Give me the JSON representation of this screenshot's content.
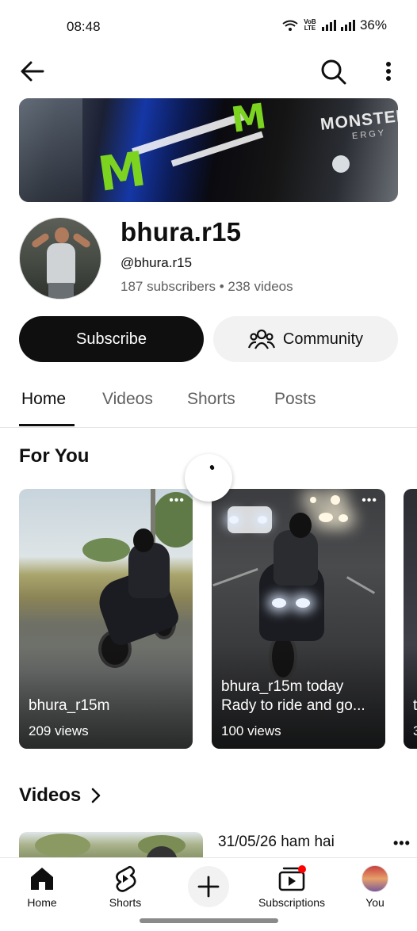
{
  "status_bar": {
    "time": "08:48",
    "volte": "VoB LTE",
    "battery": "36%"
  },
  "topbar": {
    "back_icon": "arrow-left-icon",
    "search_icon": "search-icon",
    "more_icon": "more-vertical-icon"
  },
  "banner": {
    "brand_text": "MONSTER",
    "brand_sub": "ERGY"
  },
  "channel": {
    "name": "bhura.r15",
    "handle": "@bhura.r15",
    "stats": "187 subscribers • 238 videos"
  },
  "actions": {
    "subscribe_label": "Subscribe",
    "community_label": "Community",
    "community_icon": "people-icon"
  },
  "tabs": [
    {
      "label": "Home",
      "active": true
    },
    {
      "label": "Videos",
      "active": false
    },
    {
      "label": "Shorts",
      "active": false
    },
    {
      "label": "Posts",
      "active": false
    }
  ],
  "for_you": {
    "title": "For You",
    "shorts": [
      {
        "title": "bhura_r15m",
        "views": "209 views"
      },
      {
        "title_line1": "bhura_r15m  today",
        "title_line2": "Rady to ride  and go...",
        "views": "100 views"
      },
      {
        "title": "t",
        "views": "3"
      }
    ]
  },
  "videos_section": {
    "title": "Videos",
    "first_video_title": "31/05/26   ham hai",
    "chevron_icon": "chevron-right-icon"
  },
  "bottom_nav": {
    "items": [
      {
        "label": "Home",
        "icon": "home-icon"
      },
      {
        "label": "Shorts",
        "icon": "shorts-icon"
      },
      {
        "label": "",
        "icon": "plus-icon"
      },
      {
        "label": "Subscriptions",
        "icon": "subscriptions-icon"
      },
      {
        "label": "You",
        "icon": "avatar"
      }
    ]
  },
  "colors": {
    "primary_text": "#0f0f0f",
    "secondary_text": "#606060",
    "subscribe_bg": "#0f0f0f",
    "chip_bg": "#f2f2f2",
    "notification_dot": "#ff0000"
  }
}
